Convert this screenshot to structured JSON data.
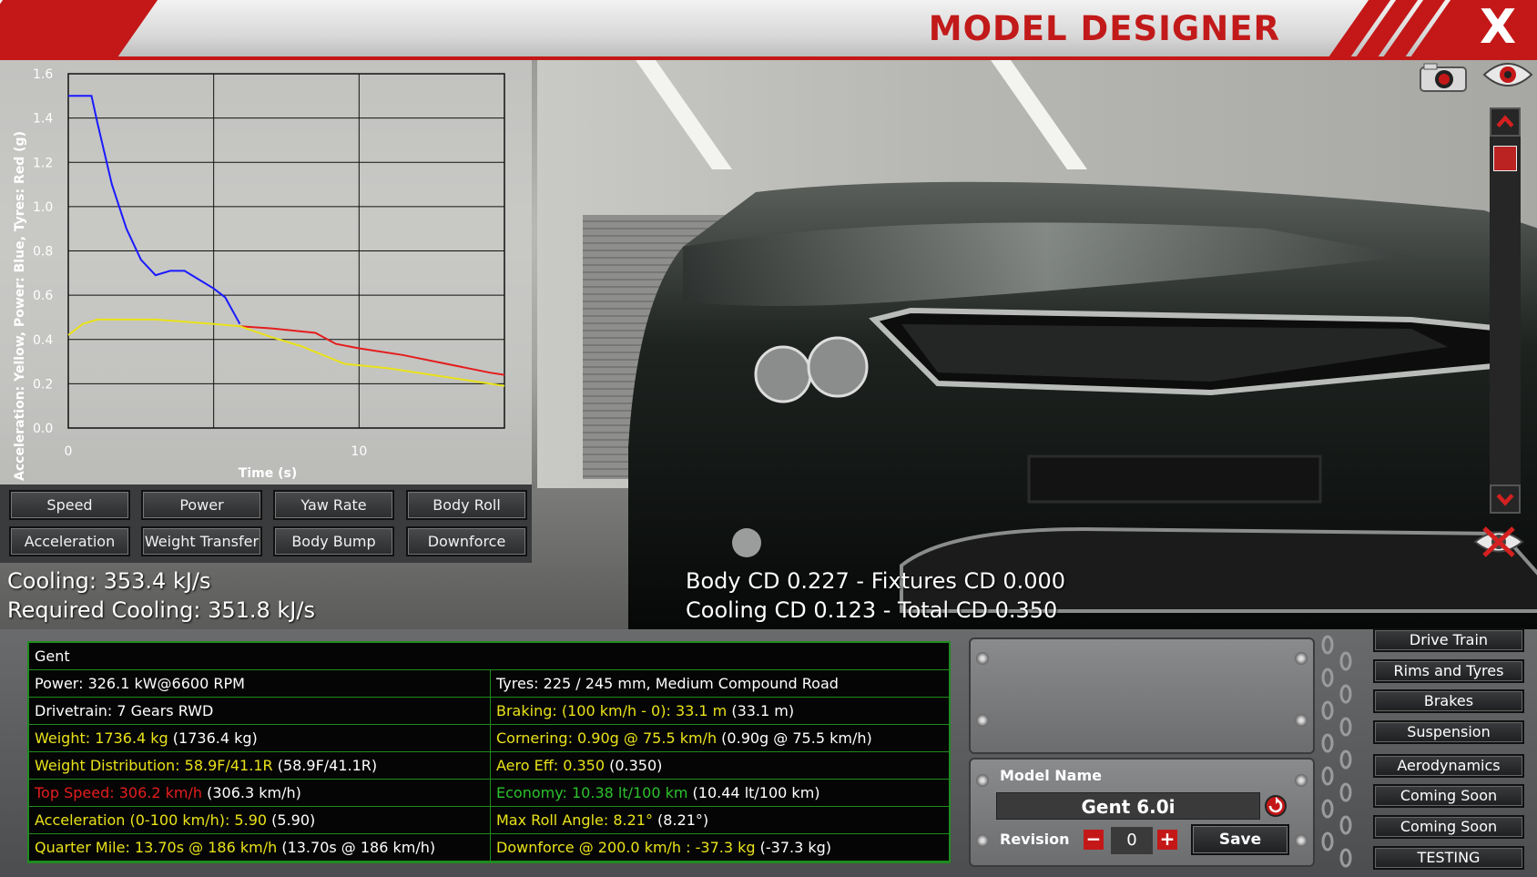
{
  "header": {
    "title": "MODEL DESIGNER",
    "close_label": "X"
  },
  "graph": {
    "ylabel": "Acceleration: Yellow, Power: Blue, Tyres: Red (g)",
    "xlabel": "Time (s)",
    "y_ticks": [
      "1.6",
      "1.4",
      "1.2",
      "1.0",
      "0.8",
      "0.6",
      "0.4",
      "0.2",
      "0.0"
    ],
    "x_ticks": [
      "0",
      "10"
    ]
  },
  "chart_data": {
    "type": "line",
    "xlabel": "Time (s)",
    "ylabel": "Acceleration: Yellow, Power: Blue, Tyres: Red (g)",
    "xlim": [
      0,
      15
    ],
    "ylim": [
      0,
      1.6
    ],
    "grid": true,
    "series": [
      {
        "color": "#1a1aff",
        "x": [
          0,
          0.8,
          1.0,
          1.5,
          2.0,
          2.5,
          3.0,
          3.5,
          4.0,
          4.5,
          5.0,
          5.4,
          5.9
        ],
        "y": [
          1.5,
          1.5,
          1.38,
          1.1,
          0.9,
          0.76,
          0.69,
          0.71,
          0.71,
          0.67,
          0.63,
          0.59,
          0.47
        ]
      },
      {
        "color": "#e41d1d",
        "x": [
          5.9,
          7.0,
          8.5,
          9.2,
          10.0,
          11.5,
          13.0,
          14.5,
          15.0
        ],
        "y": [
          0.46,
          0.45,
          0.43,
          0.38,
          0.36,
          0.33,
          0.29,
          0.25,
          0.24
        ]
      },
      {
        "color": "#e9e21a",
        "x": [
          0,
          0.5,
          1.0,
          2.0,
          3.0,
          4.0,
          5.0,
          5.9,
          7.0,
          8.0,
          9.5,
          11.0,
          12.5,
          14.0,
          15.0
        ],
        "y": [
          0.42,
          0.47,
          0.49,
          0.49,
          0.49,
          0.48,
          0.47,
          0.46,
          0.41,
          0.37,
          0.29,
          0.27,
          0.24,
          0.21,
          0.19
        ]
      }
    ]
  },
  "graph_buttons": [
    "Speed",
    "Power",
    "Yaw Rate",
    "Body Roll",
    "Acceleration",
    "Weight Transfer",
    "Body Bump",
    "Downforce"
  ],
  "stats": {
    "cooling": "Cooling: 353.4 kJ/s",
    "required_cooling": "Required Cooling: 351.8 kJ/s",
    "body_cd": "Body CD 0.227 - Fixtures CD 0.000",
    "cooling_cd": "Cooling CD 0.123 - Total CD 0.350"
  },
  "table": {
    "name": "Gent",
    "rows": [
      {
        "left": "Power: 326.1 kW@6600 RPM",
        "left_extra": "",
        "left_color": "white",
        "right": "Tyres: 225 / 245 mm, Medium Compound Road",
        "right_extra": "",
        "right_color": "white"
      },
      {
        "left": "Drivetrain: 7 Gears RWD",
        "left_extra": "",
        "left_color": "white",
        "right": "Braking: (100 km/h - 0): 33.1 m",
        "right_extra": " (33.1 m)",
        "right_color": "ylw"
      },
      {
        "left": "Weight: 1736.4 kg",
        "left_extra": " (1736.4 kg)",
        "left_color": "ylw",
        "right": "Cornering: 0.90g @ 75.5 km/h",
        "right_extra": " (0.90g @ 75.5 km/h)",
        "right_color": "ylw"
      },
      {
        "left": "Weight Distribution: 58.9F/41.1R",
        "left_extra": " (58.9F/41.1R)",
        "left_color": "ylw",
        "right": "Aero Eff: 0.350",
        "right_extra": " (0.350)",
        "right_color": "ylw"
      },
      {
        "left": "Top Speed: 306.2 km/h",
        "left_extra": " (306.3 km/h)",
        "left_color": "red",
        "right": "Economy: 10.38 lt/100 km",
        "right_extra": " (10.44 lt/100 km)",
        "right_color": "grn"
      },
      {
        "left": "Acceleration (0-100 km/h): 5.90",
        "left_extra": " (5.90)",
        "left_color": "ylw",
        "right": "Max Roll Angle: 8.21°",
        "right_extra": " (8.21°)",
        "right_color": "ylw"
      },
      {
        "left": "Quarter Mile: 13.70s @ 186 km/h",
        "left_extra": " (13.70s @ 186 km/h)",
        "left_color": "ylw",
        "right": "Downforce @ 200.0 km/h : -37.3 kg",
        "right_extra": " (-37.3 kg)",
        "right_color": "ylw"
      }
    ]
  },
  "model": {
    "name_label": "Model Name",
    "name_value": "Gent 6.0i",
    "revision_label": "Revision",
    "revision_value": "0",
    "minus_label": "−",
    "plus_label": "+",
    "save_label": "Save"
  },
  "side_buttons": [
    "Drive Train",
    "Rims and Tyres",
    "Brakes",
    "Suspension",
    "Aerodynamics",
    "Coming Soon",
    "Coming Soon",
    "TESTING"
  ]
}
